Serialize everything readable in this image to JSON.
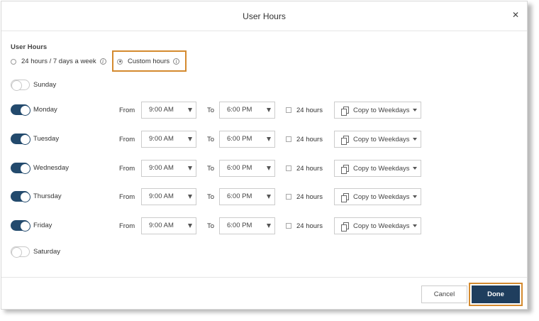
{
  "dialog": {
    "title": "User Hours",
    "close_icon": "close-icon"
  },
  "user_hours": {
    "section_title": "User Hours",
    "option_all": "24 hours / 7 days a week",
    "option_custom": "Custom hours",
    "selected": "custom"
  },
  "labels": {
    "from": "From",
    "to": "To",
    "twenty_four": "24 hours",
    "copy": "Copy to Weekdays"
  },
  "days": [
    {
      "name": "Sunday",
      "enabled": false
    },
    {
      "name": "Monday",
      "enabled": true,
      "from": "9:00 AM",
      "to": "6:00 PM",
      "all_day": false
    },
    {
      "name": "Tuesday",
      "enabled": true,
      "from": "9:00 AM",
      "to": "6:00 PM",
      "all_day": false
    },
    {
      "name": "Wednesday",
      "enabled": true,
      "from": "9:00 AM",
      "to": "6:00 PM",
      "all_day": false
    },
    {
      "name": "Thursday",
      "enabled": true,
      "from": "9:00 AM",
      "to": "6:00 PM",
      "all_day": false
    },
    {
      "name": "Friday",
      "enabled": true,
      "from": "9:00 AM",
      "to": "6:00 PM",
      "all_day": false
    },
    {
      "name": "Saturday",
      "enabled": false
    }
  ],
  "footer": {
    "cancel_label": "Cancel",
    "done_label": "Done"
  },
  "colors": {
    "primary": "#1f3e5e",
    "toggle_on": "#234a6d",
    "highlight": "#d48a2f"
  }
}
